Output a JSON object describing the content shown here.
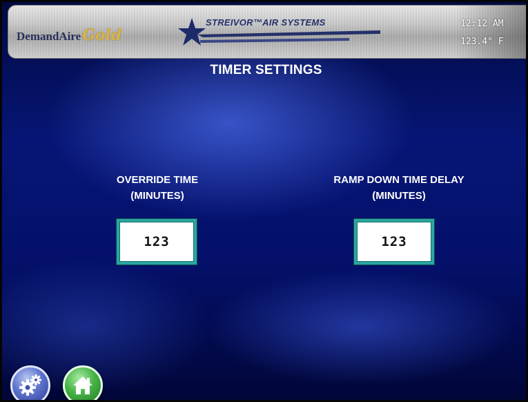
{
  "header": {
    "brand_name": "DemandAire",
    "brand_suffix": "Gold",
    "company": "STREIVOR™AIR SYSTEMS",
    "time": "12:12 AM",
    "temperature": "123.4° F"
  },
  "page": {
    "title": "TIMER SETTINGS"
  },
  "settings": {
    "override": {
      "label_line1": "OVERRIDE TIME",
      "label_line2": "(MINUTES)",
      "value": "123"
    },
    "ramp_down": {
      "label_line1": "RAMP DOWN TIME DELAY",
      "label_line2": "(MINUTES)",
      "value": "123"
    }
  },
  "nav": {
    "settings_icon": "gears-icon",
    "home_icon": "home-icon"
  },
  "colors": {
    "background": "#061575",
    "value_border": "#2aa6a2",
    "home_button": "#47b347",
    "settings_button": "#5d73cc"
  }
}
